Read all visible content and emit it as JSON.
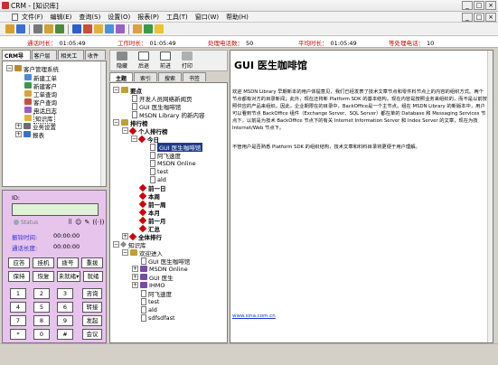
{
  "window": {
    "title": "CRM - [知识库]",
    "controls": [
      "_",
      "□",
      "×"
    ],
    "inner_controls": [
      "_",
      "□",
      "×"
    ]
  },
  "menu": [
    "文件(F)",
    "编辑(E)",
    "查询(S)",
    "设置(O)",
    "报表(P)",
    "工具(T)",
    "窗口(W)",
    "帮助(H)"
  ],
  "status": [
    {
      "label": "通话时长：",
      "value": "01:05:49"
    },
    {
      "label": "工作时长：",
      "value": "01:05:49"
    },
    {
      "label": "处理电话数：",
      "value": "50"
    },
    {
      "label": "平均时长：",
      "value": "01:05:49"
    },
    {
      "label": "等处理电话：",
      "value": "10"
    }
  ],
  "left_tabs": [
    "CRM导航",
    "客户层面",
    "相关工单",
    "收件箱"
  ],
  "left_tree": {
    "root": "客户管理系统",
    "items": [
      "新建工单",
      "新建客户",
      "工单查询",
      "客户查询",
      "电话日志",
      "知识库",
      "业务设置",
      "报表"
    ]
  },
  "phone": {
    "id_label": "ID:",
    "status": "Status",
    "icons": [
      "keypad-icon",
      "person-icon",
      "pen-icon",
      "signal-icon"
    ],
    "ring_label": "振铃时间:",
    "ring_value": "00:00:00",
    "talk_label": "通话长度:",
    "talk_value": "00:00:00",
    "btn_row1": [
      "应答",
      "挂机",
      "拨号",
      "重拨"
    ],
    "btn_row2": [
      "保持",
      "恢复",
      "未就绪",
      "就绪"
    ],
    "keys": [
      "1",
      "2",
      "3",
      "4",
      "5",
      "6",
      "7",
      "8",
      "9",
      "*",
      "0",
      "#"
    ],
    "side": [
      "咨询",
      "转接",
      "发起",
      "会议"
    ]
  },
  "kb_toolbar": [
    "隐藏",
    "后退",
    "前进",
    "打印"
  ],
  "kb_tabs": [
    "主题",
    "索引",
    "搜索",
    "书签"
  ],
  "kb_tree": [
    {
      "text": "要点",
      "bold": true
    },
    {
      "text": "开发人员网络新闻页"
    },
    {
      "text": "GUI 医生咖啡馆"
    },
    {
      "text": "MSDN Library 的新内容"
    },
    {
      "text": "排行榜",
      "bold": true
    },
    {
      "text": "个人排行榜",
      "bold": true
    },
    {
      "text": "今日",
      "bold": true
    },
    {
      "text": "GUI 医生咖啡馆"
    },
    {
      "text": "阿飞速度"
    },
    {
      "text": "MSDN Online"
    },
    {
      "text": "test"
    },
    {
      "text": "ald"
    },
    {
      "text": "前一日",
      "bold": true
    },
    {
      "text": "本周",
      "bold": true
    },
    {
      "text": "前一周",
      "bold": true
    },
    {
      "text": "本月",
      "bold": true
    },
    {
      "text": "前一月",
      "bold": true
    },
    {
      "text": "汇总",
      "bold": true
    },
    {
      "text": "全体排行",
      "bold": true
    },
    {
      "text": "知识库"
    },
    {
      "text": "欢迎进入"
    },
    {
      "text": "GUI 医生咖啡馆"
    },
    {
      "text": "MSDN Online"
    },
    {
      "text": "GUI 医生"
    },
    {
      "text": "IHMO"
    },
    {
      "text": "阿飞速度"
    },
    {
      "text": "test"
    },
    {
      "text": "ald"
    },
    {
      "text": "sdfsdfast"
    }
  ],
  "article": {
    "title": "GUI 医生咖啡馆",
    "body": "欢迎 MSDN Library 早期新本的用户体提意见，我们已经发表了技术文章节点和零件料节点上的内容的组织方式。两个节点都有对方的目录新闻；此外，现在还将新 Platform SDK 的基本结构。现在内容是按照业务来组织的，而不是以前按照供应的产品来组织。因此，企业期限在的目录中，BackOffice是一个主节点。组在 MSDN Library 的新版本中，用户可以看到节点 BackOffice 组件（Exchange Server、SQL Server）都在单的 Database 和 Messaging Services 节点下，以前是为技术 BackOffice 节点下的有关 Internet Information Server 和 Index Server 的文章，现在为技 Internet/Web 节点下。",
    "body2": "不管用户是否熟悉 Platform SDK 的组织结构，技术文章和料料目录将更便于用户理解。",
    "link": "www.sina.com.cn"
  },
  "colors": {
    "status_label": "#d00000",
    "phone_bg": "#e6c4ec",
    "phone_label": "#2b2bcf",
    "selection": "#1e3a8a",
    "link": "#1b34d8"
  }
}
